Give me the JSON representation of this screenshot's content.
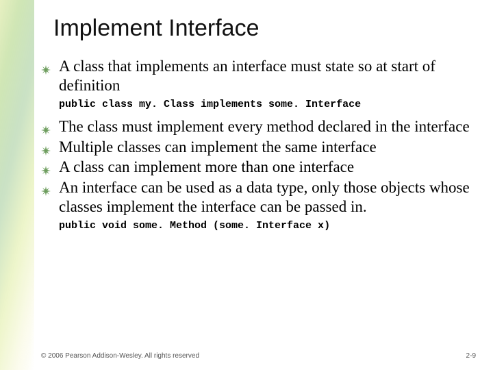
{
  "title": "Implement Interface",
  "bullets": [
    "A class that implements an interface must state so at start of definition"
  ],
  "code1": "public class my. Class implements some. Interface",
  "bullets2": [
    "The class must implement every method declared in the interface",
    "Multiple classes can implement the same interface",
    "A class can implement more than one interface",
    "An interface can be used as a data type, only those objects whose classes implement the interface can be passed in."
  ],
  "code2": "public void some. Method (some. Interface x)",
  "footer": {
    "copyright": "© 2006 Pearson Addison-Wesley. All rights reserved",
    "page": "2-9"
  },
  "bullet_color": "#6a9b5a"
}
